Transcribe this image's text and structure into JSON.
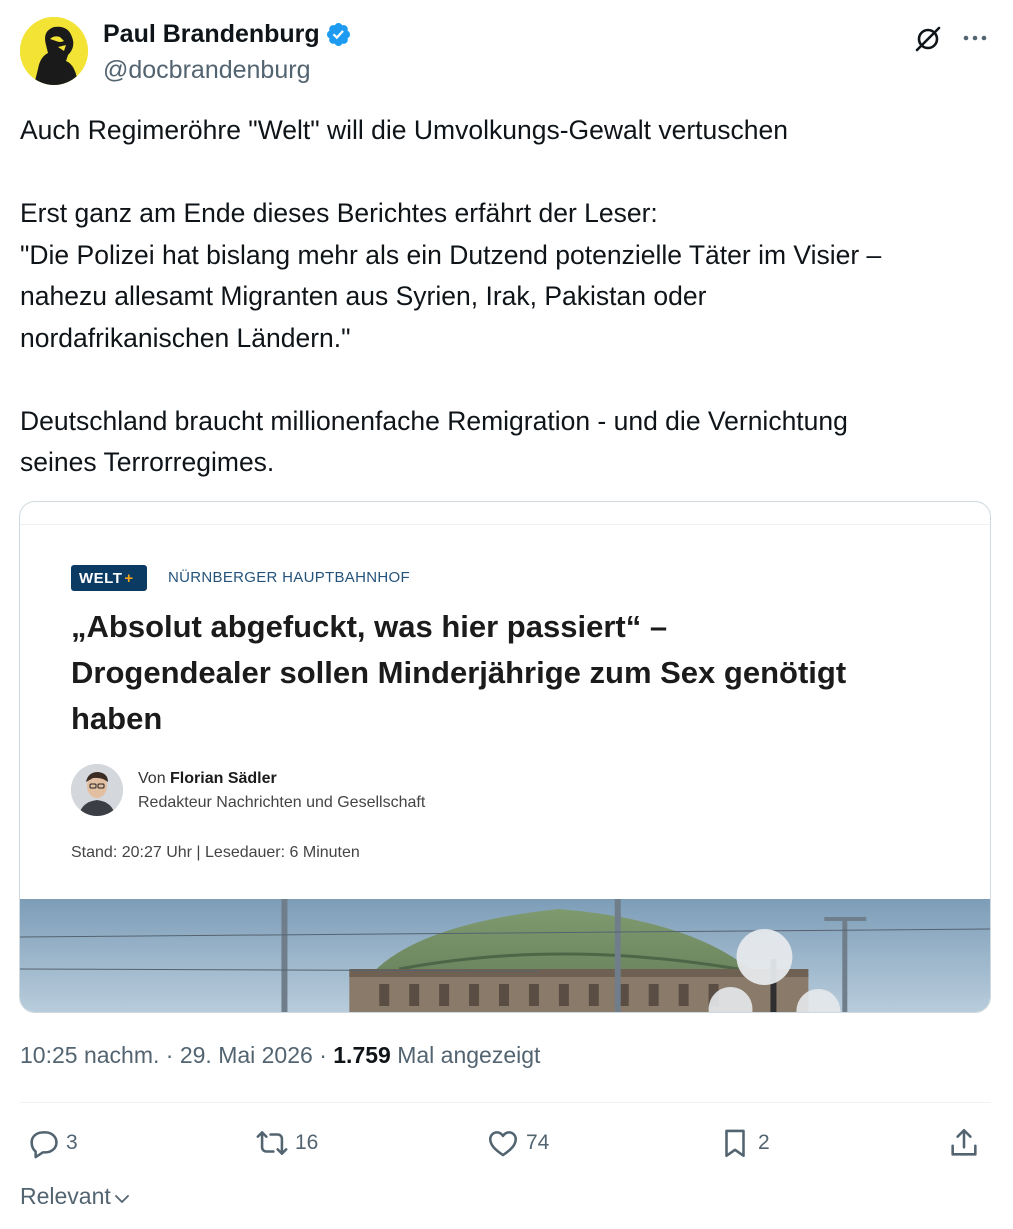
{
  "author": {
    "name": "Paul Brandenburg",
    "handle": "@docbrandenburg",
    "verified": true
  },
  "tweet": {
    "paragraphs": [
      [
        "Auch Regimeröhre \"Welt\" will die Umvolkungs-Gewalt vertuschen"
      ],
      [
        "Erst ganz am Ende dieses Berichtes erfährt der Leser:",
        "\"Die Polizei hat bislang mehr als ein Dutzend potenzielle Täter im Visier –",
        "nahezu allesamt Migranten aus Syrien, Irak, Pakistan oder",
        "nordafrikanischen Ländern.\""
      ],
      [
        "Deutschland braucht millionenfache Remigration - und die Vernichtung",
        "seines Terrorregimes."
      ]
    ]
  },
  "card": {
    "logo_text": "WELT",
    "logo_plus": "+",
    "kicker": "NÜRNBERGER HAUPTBAHNHOF",
    "headline_lines": [
      "„Absolut abgefuckt, was hier passiert“ –",
      "Drogendealer sollen Minderjährige zum Sex genötigt",
      "haben"
    ],
    "byline_prefix": "Von ",
    "author_name": "Florian Sädler",
    "author_role": "Redakteur Nachrichten und Gesellschaft",
    "stand": "Stand: 20:27 Uhr | Lesedauer: 6 Minuten"
  },
  "meta": {
    "time": "10:25 nachm.",
    "sep1": " · ",
    "date": "29. Mai 2026",
    "sep2": " · ",
    "views": "1.759",
    "views_label": " Mal angezeigt"
  },
  "actions": {
    "replies": "3",
    "reposts": "16",
    "likes": "74",
    "bookmarks": "2"
  },
  "sort": {
    "label": "Relevant"
  },
  "colors": {
    "accent": "#1d9bf0",
    "secondary_text": "#536471",
    "welt_blue": "#0b3a63"
  }
}
